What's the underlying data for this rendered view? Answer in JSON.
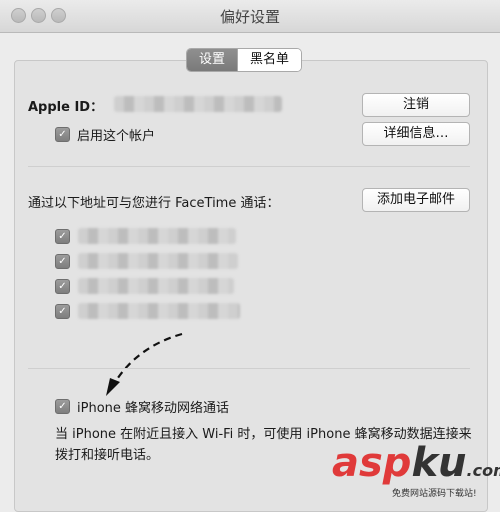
{
  "window": {
    "title": "偏好设置"
  },
  "tabs": [
    {
      "label": "设置",
      "selected": true
    },
    {
      "label": "黑名单",
      "selected": false
    }
  ],
  "apple_id": {
    "label": "Apple ID：",
    "logout_button": "注销",
    "details_button": "详细信息…",
    "enable_checkbox_label": "启用这个帐户"
  },
  "facetime": {
    "heading": "通过以下地址可与您进行 FaceTime 通话：",
    "add_email_button": "添加电子邮件"
  },
  "cellular": {
    "checkbox_label": "iPhone 蜂窝移动网络通话",
    "description": "当 iPhone 在附近且接入 Wi-Fi 时，可使用 iPhone 蜂窝移动数据连接来拨打和接听电话。"
  },
  "watermark": {
    "brand_red": "asp",
    "brand_dark": "ku",
    "domain": ".com",
    "sub": "免费网站源码下载站!"
  }
}
